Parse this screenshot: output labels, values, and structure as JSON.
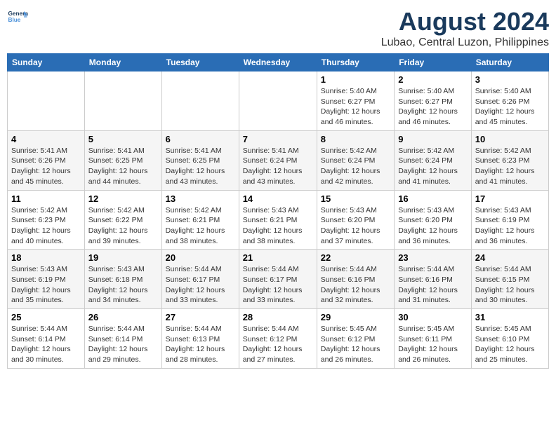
{
  "logo": {
    "line1": "General",
    "line2": "Blue"
  },
  "title": "August 2024",
  "subtitle": "Lubao, Central Luzon, Philippines",
  "weekdays": [
    "Sunday",
    "Monday",
    "Tuesday",
    "Wednesday",
    "Thursday",
    "Friday",
    "Saturday"
  ],
  "weeks": [
    [
      {
        "day": "",
        "info": ""
      },
      {
        "day": "",
        "info": ""
      },
      {
        "day": "",
        "info": ""
      },
      {
        "day": "",
        "info": ""
      },
      {
        "day": "1",
        "info": "Sunrise: 5:40 AM\nSunset: 6:27 PM\nDaylight: 12 hours\nand 46 minutes."
      },
      {
        "day": "2",
        "info": "Sunrise: 5:40 AM\nSunset: 6:27 PM\nDaylight: 12 hours\nand 46 minutes."
      },
      {
        "day": "3",
        "info": "Sunrise: 5:40 AM\nSunset: 6:26 PM\nDaylight: 12 hours\nand 45 minutes."
      }
    ],
    [
      {
        "day": "4",
        "info": "Sunrise: 5:41 AM\nSunset: 6:26 PM\nDaylight: 12 hours\nand 45 minutes."
      },
      {
        "day": "5",
        "info": "Sunrise: 5:41 AM\nSunset: 6:25 PM\nDaylight: 12 hours\nand 44 minutes."
      },
      {
        "day": "6",
        "info": "Sunrise: 5:41 AM\nSunset: 6:25 PM\nDaylight: 12 hours\nand 43 minutes."
      },
      {
        "day": "7",
        "info": "Sunrise: 5:41 AM\nSunset: 6:24 PM\nDaylight: 12 hours\nand 43 minutes."
      },
      {
        "day": "8",
        "info": "Sunrise: 5:42 AM\nSunset: 6:24 PM\nDaylight: 12 hours\nand 42 minutes."
      },
      {
        "day": "9",
        "info": "Sunrise: 5:42 AM\nSunset: 6:24 PM\nDaylight: 12 hours\nand 41 minutes."
      },
      {
        "day": "10",
        "info": "Sunrise: 5:42 AM\nSunset: 6:23 PM\nDaylight: 12 hours\nand 41 minutes."
      }
    ],
    [
      {
        "day": "11",
        "info": "Sunrise: 5:42 AM\nSunset: 6:23 PM\nDaylight: 12 hours\nand 40 minutes."
      },
      {
        "day": "12",
        "info": "Sunrise: 5:42 AM\nSunset: 6:22 PM\nDaylight: 12 hours\nand 39 minutes."
      },
      {
        "day": "13",
        "info": "Sunrise: 5:42 AM\nSunset: 6:21 PM\nDaylight: 12 hours\nand 38 minutes."
      },
      {
        "day": "14",
        "info": "Sunrise: 5:43 AM\nSunset: 6:21 PM\nDaylight: 12 hours\nand 38 minutes."
      },
      {
        "day": "15",
        "info": "Sunrise: 5:43 AM\nSunset: 6:20 PM\nDaylight: 12 hours\nand 37 minutes."
      },
      {
        "day": "16",
        "info": "Sunrise: 5:43 AM\nSunset: 6:20 PM\nDaylight: 12 hours\nand 36 minutes."
      },
      {
        "day": "17",
        "info": "Sunrise: 5:43 AM\nSunset: 6:19 PM\nDaylight: 12 hours\nand 36 minutes."
      }
    ],
    [
      {
        "day": "18",
        "info": "Sunrise: 5:43 AM\nSunset: 6:19 PM\nDaylight: 12 hours\nand 35 minutes."
      },
      {
        "day": "19",
        "info": "Sunrise: 5:43 AM\nSunset: 6:18 PM\nDaylight: 12 hours\nand 34 minutes."
      },
      {
        "day": "20",
        "info": "Sunrise: 5:44 AM\nSunset: 6:17 PM\nDaylight: 12 hours\nand 33 minutes."
      },
      {
        "day": "21",
        "info": "Sunrise: 5:44 AM\nSunset: 6:17 PM\nDaylight: 12 hours\nand 33 minutes."
      },
      {
        "day": "22",
        "info": "Sunrise: 5:44 AM\nSunset: 6:16 PM\nDaylight: 12 hours\nand 32 minutes."
      },
      {
        "day": "23",
        "info": "Sunrise: 5:44 AM\nSunset: 6:16 PM\nDaylight: 12 hours\nand 31 minutes."
      },
      {
        "day": "24",
        "info": "Sunrise: 5:44 AM\nSunset: 6:15 PM\nDaylight: 12 hours\nand 30 minutes."
      }
    ],
    [
      {
        "day": "25",
        "info": "Sunrise: 5:44 AM\nSunset: 6:14 PM\nDaylight: 12 hours\nand 30 minutes."
      },
      {
        "day": "26",
        "info": "Sunrise: 5:44 AM\nSunset: 6:14 PM\nDaylight: 12 hours\nand 29 minutes."
      },
      {
        "day": "27",
        "info": "Sunrise: 5:44 AM\nSunset: 6:13 PM\nDaylight: 12 hours\nand 28 minutes."
      },
      {
        "day": "28",
        "info": "Sunrise: 5:44 AM\nSunset: 6:12 PM\nDaylight: 12 hours\nand 27 minutes."
      },
      {
        "day": "29",
        "info": "Sunrise: 5:45 AM\nSunset: 6:12 PM\nDaylight: 12 hours\nand 26 minutes."
      },
      {
        "day": "30",
        "info": "Sunrise: 5:45 AM\nSunset: 6:11 PM\nDaylight: 12 hours\nand 26 minutes."
      },
      {
        "day": "31",
        "info": "Sunrise: 5:45 AM\nSunset: 6:10 PM\nDaylight: 12 hours\nand 25 minutes."
      }
    ]
  ]
}
